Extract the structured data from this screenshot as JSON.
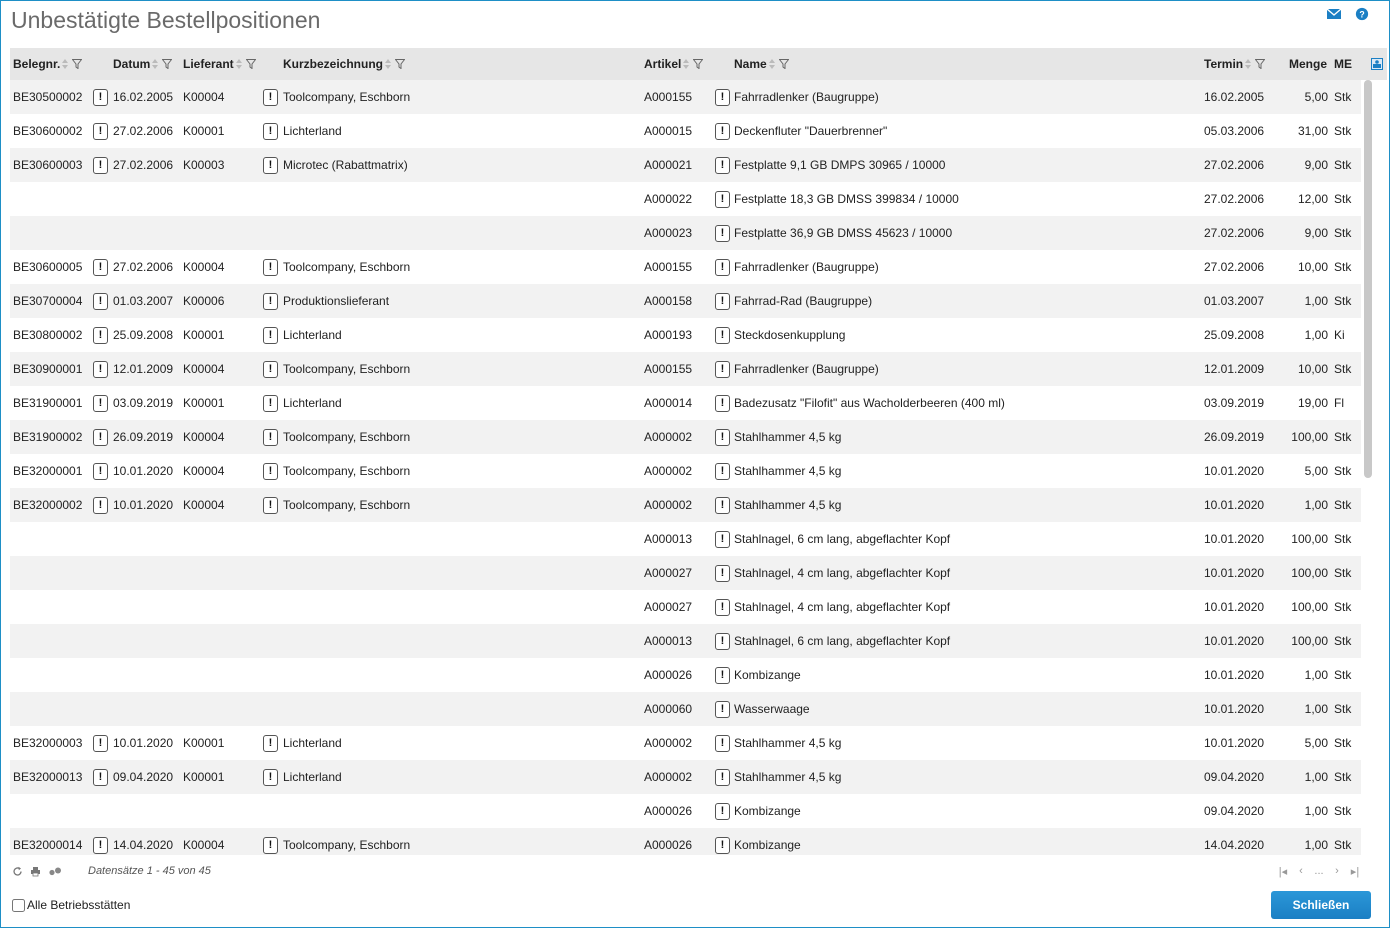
{
  "title": "Unbestätigte Bestellpositionen",
  "header_icons": [
    "mail-icon",
    "help-icon"
  ],
  "columns": {
    "belegnr": "Belegnr.",
    "datum": "Datum",
    "lieferant": "Lieferant",
    "kurzbezeichnung": "Kurzbezeichnung",
    "artikel": "Artikel",
    "name": "Name",
    "termin": "Termin",
    "menge": "Menge",
    "me": "ME"
  },
  "rows": [
    {
      "belegnr": "BE30500002",
      "datum": "16.02.2005",
      "lieferant": "K00004",
      "kurz": "Toolcompany, Eschborn",
      "artikel": "A000155",
      "name": "Fahrradlenker (Baugruppe)",
      "termin": "16.02.2005",
      "menge": "5,00",
      "me": "Stk"
    },
    {
      "belegnr": "BE30600002",
      "datum": "27.02.2006",
      "lieferant": "K00001",
      "kurz": "Lichterland",
      "artikel": "A000015",
      "name": "Deckenfluter \"Dauerbrenner\"",
      "termin": "05.03.2006",
      "menge": "31,00",
      "me": "Stk"
    },
    {
      "belegnr": "BE30600003",
      "datum": "27.02.2006",
      "lieferant": "K00003",
      "kurz": "Microtec (Rabattmatrix)",
      "artikel": "A000021",
      "name": "Festplatte 9,1 GB DMPS 30965 / 10000",
      "termin": "27.02.2006",
      "menge": "9,00",
      "me": "Stk"
    },
    {
      "belegnr": "",
      "datum": "",
      "lieferant": "",
      "kurz": "",
      "artikel": "A000022",
      "name": "Festplatte 18,3 GB DMSS 399834 / 10000",
      "termin": "27.02.2006",
      "menge": "12,00",
      "me": "Stk"
    },
    {
      "belegnr": "",
      "datum": "",
      "lieferant": "",
      "kurz": "",
      "artikel": "A000023",
      "name": "Festplatte 36,9 GB DMSS 45623 / 10000",
      "termin": "27.02.2006",
      "menge": "9,00",
      "me": "Stk"
    },
    {
      "belegnr": "BE30600005",
      "datum": "27.02.2006",
      "lieferant": "K00004",
      "kurz": "Toolcompany, Eschborn",
      "artikel": "A000155",
      "name": "Fahrradlenker (Baugruppe)",
      "termin": "27.02.2006",
      "menge": "10,00",
      "me": "Stk"
    },
    {
      "belegnr": "BE30700004",
      "datum": "01.03.2007",
      "lieferant": "K00006",
      "kurz": "Produktionslieferant",
      "artikel": "A000158",
      "name": "Fahrrad-Rad (Baugruppe)",
      "termin": "01.03.2007",
      "menge": "1,00",
      "me": "Stk"
    },
    {
      "belegnr": "BE30800002",
      "datum": "25.09.2008",
      "lieferant": "K00001",
      "kurz": "Lichterland",
      "artikel": "A000193",
      "name": "Steckdosenkupplung",
      "termin": "25.09.2008",
      "menge": "1,00",
      "me": "Ki"
    },
    {
      "belegnr": "BE30900001",
      "datum": "12.01.2009",
      "lieferant": "K00004",
      "kurz": "Toolcompany, Eschborn",
      "artikel": "A000155",
      "name": "Fahrradlenker (Baugruppe)",
      "termin": "12.01.2009",
      "menge": "10,00",
      "me": "Stk"
    },
    {
      "belegnr": "BE31900001",
      "datum": "03.09.2019",
      "lieferant": "K00001",
      "kurz": "Lichterland",
      "artikel": "A000014",
      "name": "Badezusatz \"Filofit\" aus Wacholderbeeren (400 ml)",
      "termin": "03.09.2019",
      "menge": "19,00",
      "me": "Fl"
    },
    {
      "belegnr": "BE31900002",
      "datum": "26.09.2019",
      "lieferant": "K00004",
      "kurz": "Toolcompany, Eschborn",
      "artikel": "A000002",
      "name": "Stahlhammer 4,5 kg",
      "termin": "26.09.2019",
      "menge": "100,00",
      "me": "Stk"
    },
    {
      "belegnr": "BE32000001",
      "datum": "10.01.2020",
      "lieferant": "K00004",
      "kurz": "Toolcompany, Eschborn",
      "artikel": "A000002",
      "name": "Stahlhammer 4,5 kg",
      "termin": "10.01.2020",
      "menge": "5,00",
      "me": "Stk"
    },
    {
      "belegnr": "BE32000002",
      "datum": "10.01.2020",
      "lieferant": "K00004",
      "kurz": "Toolcompany, Eschborn",
      "artikel": "A000002",
      "name": "Stahlhammer 4,5 kg",
      "termin": "10.01.2020",
      "menge": "1,00",
      "me": "Stk"
    },
    {
      "belegnr": "",
      "datum": "",
      "lieferant": "",
      "kurz": "",
      "artikel": "A000013",
      "name": "Stahlnagel, 6 cm lang, abgeflachter Kopf",
      "termin": "10.01.2020",
      "menge": "100,00",
      "me": "Stk"
    },
    {
      "belegnr": "",
      "datum": "",
      "lieferant": "",
      "kurz": "",
      "artikel": "A000027",
      "name": "Stahlnagel, 4 cm lang, abgeflachter Kopf",
      "termin": "10.01.2020",
      "menge": "100,00",
      "me": "Stk"
    },
    {
      "belegnr": "",
      "datum": "",
      "lieferant": "",
      "kurz": "",
      "artikel": "A000027",
      "name": "Stahlnagel, 4 cm lang, abgeflachter Kopf",
      "termin": "10.01.2020",
      "menge": "100,00",
      "me": "Stk"
    },
    {
      "belegnr": "",
      "datum": "",
      "lieferant": "",
      "kurz": "",
      "artikel": "A000013",
      "name": "Stahlnagel, 6 cm lang, abgeflachter Kopf",
      "termin": "10.01.2020",
      "menge": "100,00",
      "me": "Stk"
    },
    {
      "belegnr": "",
      "datum": "",
      "lieferant": "",
      "kurz": "",
      "artikel": "A000026",
      "name": "Kombizange",
      "termin": "10.01.2020",
      "menge": "1,00",
      "me": "Stk"
    },
    {
      "belegnr": "",
      "datum": "",
      "lieferant": "",
      "kurz": "",
      "artikel": "A000060",
      "name": "Wasserwaage",
      "termin": "10.01.2020",
      "menge": "1,00",
      "me": "Stk"
    },
    {
      "belegnr": "BE32000003",
      "datum": "10.01.2020",
      "lieferant": "K00001",
      "kurz": "Lichterland",
      "artikel": "A000002",
      "name": "Stahlhammer 4,5 kg",
      "termin": "10.01.2020",
      "menge": "5,00",
      "me": "Stk"
    },
    {
      "belegnr": "BE32000013",
      "datum": "09.04.2020",
      "lieferant": "K00001",
      "kurz": "Lichterland",
      "artikel": "A000002",
      "name": "Stahlhammer 4,5 kg",
      "termin": "09.04.2020",
      "menge": "1,00",
      "me": "Stk"
    },
    {
      "belegnr": "",
      "datum": "",
      "lieferant": "",
      "kurz": "",
      "artikel": "A000026",
      "name": "Kombizange",
      "termin": "09.04.2020",
      "menge": "1,00",
      "me": "Stk"
    },
    {
      "belegnr": "BE32000014",
      "datum": "14.04.2020",
      "lieferant": "K00004",
      "kurz": "Toolcompany, Eschborn",
      "artikel": "A000026",
      "name": "Kombizange",
      "termin": "14.04.2020",
      "menge": "1,00",
      "me": "Stk"
    }
  ],
  "footer": {
    "records": "Datensätze 1 - 45 von 45",
    "pager_ellipsis": "..."
  },
  "checkbox_label": "Alle Betriebsstätten",
  "close_label": "Schließen",
  "colors": {
    "accent": "#1b7fc4",
    "header_bg": "#e6e6e6",
    "row_alt": "#f2f2f2",
    "title": "#6a6a6a"
  }
}
